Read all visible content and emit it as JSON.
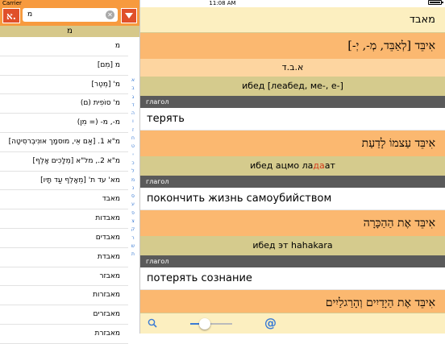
{
  "status": {
    "carrier": "Carrier",
    "time": "11:08 AM"
  },
  "sidebar": {
    "logo": "א.",
    "search": {
      "value": "מ",
      "placeholder": ""
    },
    "letter_header": "מ",
    "items": [
      "מ",
      "מ [מִם]",
      "מ' [מְטֶר]",
      "מ' סוֹפִית (ם)",
      "מ-, מ- (= מִן)",
      "מ\"א 1. [אַם אֵי, מוּסמָך אוּנִיבֶרסִיטָה]",
      "מ\"א 2., מל\"א [מְלָכִים אָלֶף]",
      "מא' עד ת' [מֵאָלֶף עַד תָּיו]",
      "מאבד",
      "מאבדות",
      "מאבדים",
      "מאבדת",
      "מאבזר",
      "מאבזרות",
      "מאבזרים",
      "מאבזרת"
    ],
    "alpha_index": [
      "א",
      "ב",
      "ג",
      "ד",
      "ה",
      "ו",
      "ז",
      "ח",
      "ט",
      "י",
      "כ",
      "ל",
      "מ",
      "נ",
      "ס",
      "ע",
      "פ",
      "צ",
      "ק",
      "ר",
      "ש",
      "ת"
    ]
  },
  "main": {
    "title": "מאבד",
    "entries": [
      {
        "hebrew": "אִיבֵּד [לְאַבֵּד, מְ-, יְ-]",
        "root": "א.ב.ד",
        "translit_pre": "ибед [леабед, ме-, е-]",
        "translit_stress": "",
        "translit_post": "",
        "pos": "глагол",
        "translation": "терять"
      },
      {
        "hebrew": "אִיבֵּד עַצמוֹ לָדַעַת",
        "root": "",
        "translit_pre": "ибед ацмо ла",
        "translit_stress": "да",
        "translit_post": "ат",
        "pos": "глагол",
        "translation": "покончить жизнь самоубийством"
      },
      {
        "hebrew": "אִיבֵּד אֶת הַהַכָּרָה",
        "root": "",
        "translit_pre": "ибед эт hahakara",
        "translit_stress": "",
        "translit_post": "",
        "pos": "глагол",
        "translation": "потерять сознание"
      },
      {
        "hebrew": "אִיבֵּד אֶת הַיָדַיִים וְהָרַגלַיִים",
        "root": "",
        "translit_pre": "",
        "translit_stress": "",
        "translit_post": "",
        "pos": "",
        "translation": ""
      }
    ]
  },
  "toolbar": {
    "font_size_fraction": 0.35
  },
  "colors": {
    "accent": "#f79a3e",
    "brand": "#e0502a",
    "link": "#3a7bd5"
  }
}
